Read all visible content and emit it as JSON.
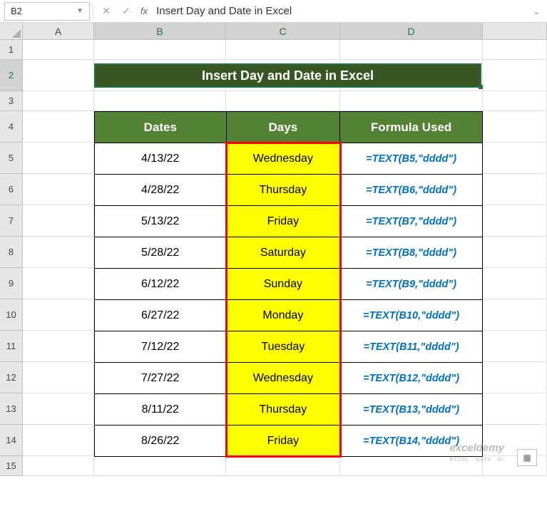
{
  "nameBox": "B2",
  "formulaBar": "Insert Day and Date in Excel",
  "columns": [
    "A",
    "B",
    "C",
    "D"
  ],
  "rowNums": [
    1,
    2,
    3,
    4,
    5,
    6,
    7,
    8,
    9,
    10,
    11,
    12,
    13,
    14,
    15
  ],
  "title": "Insert Day and Date in Excel",
  "headers": {
    "dates": "Dates",
    "days": "Days",
    "formula": "Formula Used"
  },
  "rows": [
    {
      "date": "4/13/22",
      "day": "Wednesday",
      "formula": "=TEXT(B5,\"dddd\")"
    },
    {
      "date": "4/28/22",
      "day": "Thursday",
      "formula": "=TEXT(B6,\"dddd\")"
    },
    {
      "date": "5/13/22",
      "day": "Friday",
      "formula": "=TEXT(B7,\"dddd\")"
    },
    {
      "date": "5/28/22",
      "day": "Saturday",
      "formula": "=TEXT(B8,\"dddd\")"
    },
    {
      "date": "6/12/22",
      "day": "Sunday",
      "formula": "=TEXT(B9,\"dddd\")"
    },
    {
      "date": "6/27/22",
      "day": "Monday",
      "formula": "=TEXT(B10,\"dddd\")"
    },
    {
      "date": "7/12/22",
      "day": "Tuesday",
      "formula": "=TEXT(B11,\"dddd\")"
    },
    {
      "date": "7/27/22",
      "day": "Wednesday",
      "formula": "=TEXT(B12,\"dddd\")"
    },
    {
      "date": "8/11/22",
      "day": "Thursday",
      "formula": "=TEXT(B13,\"dddd\")"
    },
    {
      "date": "8/26/22",
      "day": "Friday",
      "formula": "=TEXT(B14,\"dddd\")"
    }
  ],
  "watermark": {
    "brand": "exceldemy",
    "tag": "EXCEL · DATA · BI"
  },
  "chart_data": {
    "type": "table",
    "title": "Insert Day and Date in Excel",
    "columns": [
      "Dates",
      "Days",
      "Formula Used"
    ],
    "rows": [
      [
        "4/13/22",
        "Wednesday",
        "=TEXT(B5,\"dddd\")"
      ],
      [
        "4/28/22",
        "Thursday",
        "=TEXT(B6,\"dddd\")"
      ],
      [
        "5/13/22",
        "Friday",
        "=TEXT(B7,\"dddd\")"
      ],
      [
        "5/28/22",
        "Saturday",
        "=TEXT(B8,\"dddd\")"
      ],
      [
        "6/12/22",
        "Sunday",
        "=TEXT(B9,\"dddd\")"
      ],
      [
        "6/27/22",
        "Monday",
        "=TEXT(B10,\"dddd\")"
      ],
      [
        "7/12/22",
        "Tuesday",
        "=TEXT(B11,\"dddd\")"
      ],
      [
        "7/27/22",
        "Wednesday",
        "=TEXT(B12,\"dddd\")"
      ],
      [
        "8/11/22",
        "Thursday",
        "=TEXT(B13,\"dddd\")"
      ],
      [
        "8/26/22",
        "Friday",
        "=TEXT(B14,\"dddd\")"
      ]
    ]
  }
}
